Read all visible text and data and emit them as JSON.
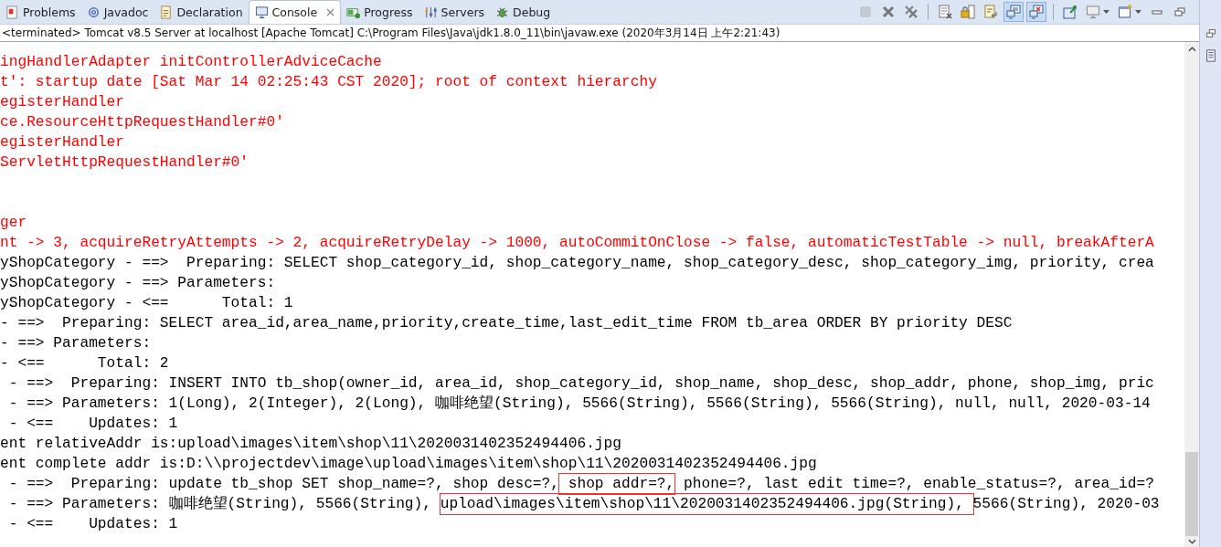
{
  "tabs": [
    {
      "label": "Problems",
      "selected": false
    },
    {
      "label": "Javadoc",
      "selected": false
    },
    {
      "label": "Declaration",
      "selected": false
    },
    {
      "label": "Console",
      "selected": true
    },
    {
      "label": "Progress",
      "selected": false
    },
    {
      "label": "Servers",
      "selected": false
    },
    {
      "label": "Debug",
      "selected": false
    }
  ],
  "toolbar": [
    {
      "kind": "stop",
      "pressed": false,
      "disabled": true
    },
    {
      "kind": "remove",
      "pressed": false,
      "disabled": false
    },
    {
      "kind": "remove-all",
      "pressed": false,
      "disabled": false
    },
    {
      "kind": "sep"
    },
    {
      "kind": "clear",
      "pressed": false,
      "disabled": false
    },
    {
      "kind": "lock",
      "pressed": false,
      "disabled": false
    },
    {
      "kind": "wrap",
      "pressed": false,
      "disabled": false
    },
    {
      "kind": "stdout",
      "pressed": true,
      "disabled": false
    },
    {
      "kind": "stderr",
      "pressed": true,
      "disabled": false
    },
    {
      "kind": "sep"
    },
    {
      "kind": "pin",
      "pressed": false,
      "disabled": false
    },
    {
      "kind": "display",
      "pressed": false,
      "disabled": false
    },
    {
      "kind": "open",
      "pressed": false,
      "disabled": false
    },
    {
      "kind": "minimize",
      "pressed": false,
      "disabled": false
    },
    {
      "kind": "maximize",
      "pressed": false,
      "disabled": false
    }
  ],
  "console": {
    "process": "<terminated> Tomcat v8.5 Server at localhost [Apache Tomcat] C:\\Program Files\\Java\\jdk1.8.0_11\\bin\\javaw.exe (2020年3月14日 上午2:21:43)",
    "lines": [
      {
        "kind": "stderr",
        "segments": [
          {
            "text": "ingHandlerAdapter initControllerAdviceCache",
            "boxed": false
          }
        ]
      },
      {
        "kind": "stderr",
        "segments": [
          {
            "text": "t': startup date [Sat Mar 14 02:25:43 CST 2020]; root of context hierarchy",
            "boxed": false
          }
        ]
      },
      {
        "kind": "stderr",
        "segments": [
          {
            "text": "egisterHandler",
            "boxed": false
          }
        ]
      },
      {
        "kind": "stderr",
        "segments": [
          {
            "text": "ce.ResourceHttpRequestHandler#0'",
            "boxed": false
          }
        ]
      },
      {
        "kind": "stderr",
        "segments": [
          {
            "text": "egisterHandler",
            "boxed": false
          }
        ]
      },
      {
        "kind": "stderr",
        "segments": [
          {
            "text": "ServletHttpRequestHandler#0'",
            "boxed": false
          }
        ]
      },
      {
        "kind": "blank"
      },
      {
        "kind": "blank"
      },
      {
        "kind": "stderr",
        "segments": [
          {
            "text": "ger",
            "boxed": false
          }
        ]
      },
      {
        "kind": "stderr",
        "segments": [
          {
            "text": "nt -> 3, acquireRetryAttempts -> 2, acquireRetryDelay -> 1000, autoCommitOnClose -> false, automaticTestTable -> null, breakAfterA",
            "boxed": false
          }
        ]
      },
      {
        "kind": "stdout",
        "segments": [
          {
            "text": "yShopCategory - ==>  Preparing: SELECT shop_category_id, shop_category_name, shop_category_desc, shop_category_img, priority, crea",
            "boxed": false
          }
        ]
      },
      {
        "kind": "stdout",
        "segments": [
          {
            "text": "yShopCategory - ==> Parameters: ",
            "boxed": false
          }
        ]
      },
      {
        "kind": "stdout",
        "segments": [
          {
            "text": "yShopCategory - <==      Total: 1",
            "boxed": false
          }
        ]
      },
      {
        "kind": "stdout",
        "segments": [
          {
            "text": "- ==>  Preparing: SELECT area_id,area_name,priority,create_time,last_edit_time FROM tb_area ORDER BY priority DESC",
            "boxed": false
          }
        ]
      },
      {
        "kind": "stdout",
        "segments": [
          {
            "text": "- ==> Parameters: ",
            "boxed": false
          }
        ]
      },
      {
        "kind": "stdout",
        "segments": [
          {
            "text": "- <==      Total: 2",
            "boxed": false
          }
        ]
      },
      {
        "kind": "stdout",
        "segments": [
          {
            "text": " - ==>  Preparing: INSERT INTO tb_shop(owner_id, area_id, shop_category_id, shop_name, shop_desc, shop_addr, phone, shop_img, pric",
            "boxed": false
          }
        ]
      },
      {
        "kind": "stdout",
        "segments": [
          {
            "text": " - ==> Parameters: 1(Long), 2(Integer), 2(Long), 咖啡绝望(String), 5566(String), 5566(String), 5566(String), null, null, 2020-03-14",
            "boxed": false
          }
        ]
      },
      {
        "kind": "stdout",
        "segments": [
          {
            "text": " - <==    Updates: 1",
            "boxed": false
          }
        ]
      },
      {
        "kind": "stdout",
        "segments": [
          {
            "text": "ent relativeAddr is:upload\\images\\item\\shop\\11\\2020031402352494406.jpg",
            "boxed": false
          }
        ]
      },
      {
        "kind": "stdout",
        "segments": [
          {
            "text": "ent complete addr is:D:\\\\projectdev\\image\\upload\\images\\item\\shop\\11\\2020031402352494406.jpg",
            "boxed": false
          }
        ]
      },
      {
        "kind": "stdout",
        "segments": [
          {
            "text": " - ==>  Preparing: update tb_shop SET shop_name=?, shop desc=?,",
            "boxed": false
          },
          {
            "text": " shop addr=?,",
            "boxed": true
          },
          {
            "text": " phone=?, last edit time=?, enable_status=?, area_id=?",
            "boxed": false
          }
        ]
      },
      {
        "kind": "stdout",
        "segments": [
          {
            "text": " - ==> Parameters: 咖啡绝望(String), 5566(String), ",
            "boxed": false
          },
          {
            "text": "upload\\images\\item\\shop\\11\\2020031402352494406.jpg(String), ",
            "boxed": true
          },
          {
            "text": "5566(String), 2020-03",
            "boxed": false
          }
        ]
      },
      {
        "kind": "stdout",
        "segments": [
          {
            "text": " - <==    Updates: 1",
            "boxed": false
          }
        ]
      }
    ]
  }
}
